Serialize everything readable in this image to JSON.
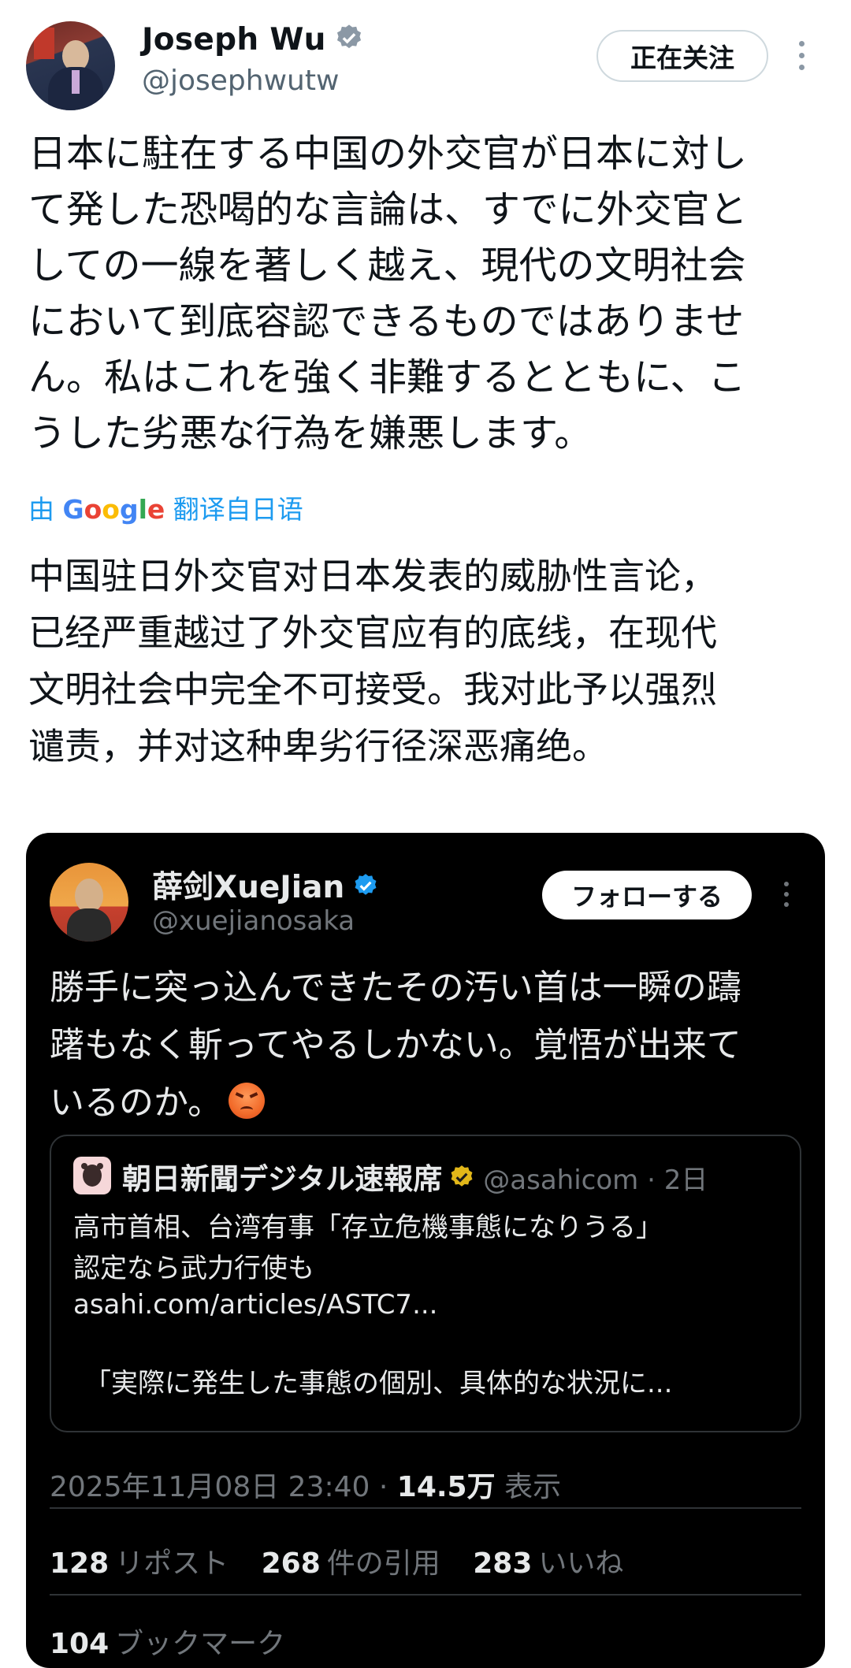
{
  "author": {
    "name": "Joseph Wu",
    "handle": "@josephwutw",
    "follow_label": "正在关注",
    "verified_icon": "verified-badge-blue"
  },
  "post": {
    "text": "日本に駐在する中国の外交官が日本に対し\nて発した恐喝的な言論は、すでに外交官と\nしての一線を著しく越え、現代の文明社会\nにおいて到底容認できるものではありませ\nん。私はこれを強く非難するとともに、こ\nうした劣悪な行為を嫌悪します。",
    "translate_prefix": "由",
    "translate_brand": "Google",
    "translate_suffix": "翻译自日语",
    "translated_text": "中国驻日外交官对日本发表的威胁性言论，\n已经严重越过了外交官应有的底线，在现代\n文明社会中完全不可接受。我对此予以强烈\n谴责，并对这种卑劣行径深恶痛绝。"
  },
  "embedded": {
    "name": "薛剑XueJian",
    "handle": "@xuejianosaka",
    "follow_label": "フォローする",
    "text": "勝手に突っ込んできたその汚い首は一瞬の躊\n躇もなく斬ってやるしかない。覚悟が出来て\nいるのか。",
    "emoji": "angry-face",
    "quote": {
      "name": "朝日新聞デジタル速報席",
      "handle": "@asahicom",
      "time": "2日",
      "text": "高市首相、台湾有事「存立危機事態になりうる」\n認定なら武力行使も",
      "link": "asahi.com/articles/ASTC7...",
      "excerpt": "「実際に発生した事態の個別、具体的な状況に..."
    },
    "timestamp": "2025年11月08日 23:40",
    "views_count": "14.5万",
    "views_label": "表示",
    "stats": {
      "reposts_count": "128",
      "reposts_label": "リポスト",
      "quotes_count": "268",
      "quotes_label": "件の引用",
      "likes_count": "283",
      "likes_label": "いいね"
    },
    "bookmarks_count": "104",
    "bookmarks_label": "ブックマーク"
  },
  "colors": {
    "link_blue": "#1d9bf0",
    "text_dark": "#0f1419",
    "muted": "#536471",
    "embed_bg": "#000000"
  }
}
